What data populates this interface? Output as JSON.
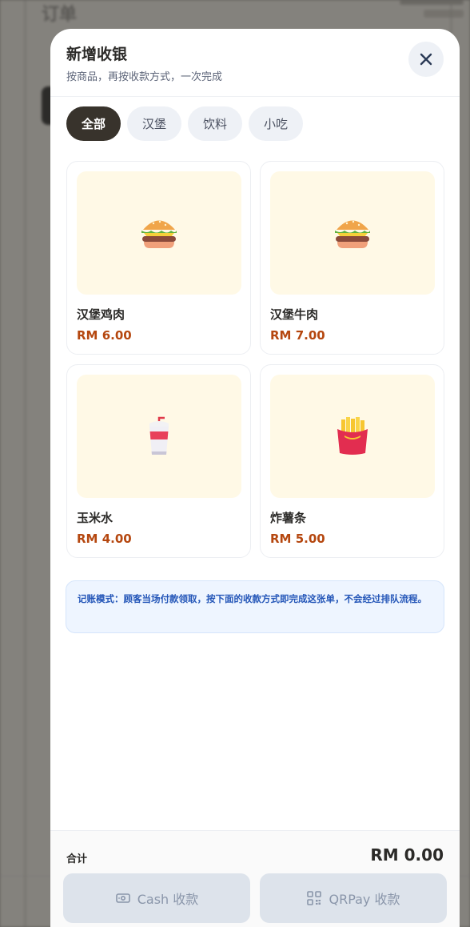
{
  "background": {
    "page_title": "订单"
  },
  "modal": {
    "title": "新增收银",
    "subtitle": "按商品，再按收款方式，一次完成"
  },
  "tabs": [
    {
      "label": "全部",
      "active": true
    },
    {
      "label": "汉堡",
      "active": false
    },
    {
      "label": "饮料",
      "active": false
    },
    {
      "label": "小吃",
      "active": false
    }
  ],
  "products": [
    {
      "name": "汉堡鸡肉",
      "price": "RM 6.00",
      "icon": "burger-icon"
    },
    {
      "name": "汉堡牛肉",
      "price": "RM 7.00",
      "icon": "burger-icon"
    },
    {
      "name": "玉米水",
      "price": "RM 4.00",
      "icon": "drink-cup-icon"
    },
    {
      "name": "炸薯条",
      "price": "RM 5.00",
      "icon": "fries-icon"
    }
  ],
  "notice": "记账模式：顾客当场付款领取，按下面的收款方式即完成这张单，不会经过排队流程。",
  "footer": {
    "total_label": "合计",
    "total_value": "RM 0.00",
    "cash_label": "Cash 收款",
    "qrpay_label": "QRPay 收款"
  },
  "colors": {
    "accent_dark": "#38332c",
    "price": "#b5470f",
    "notice_text": "#2456b8",
    "card_image_bg": "#fff9e6"
  }
}
